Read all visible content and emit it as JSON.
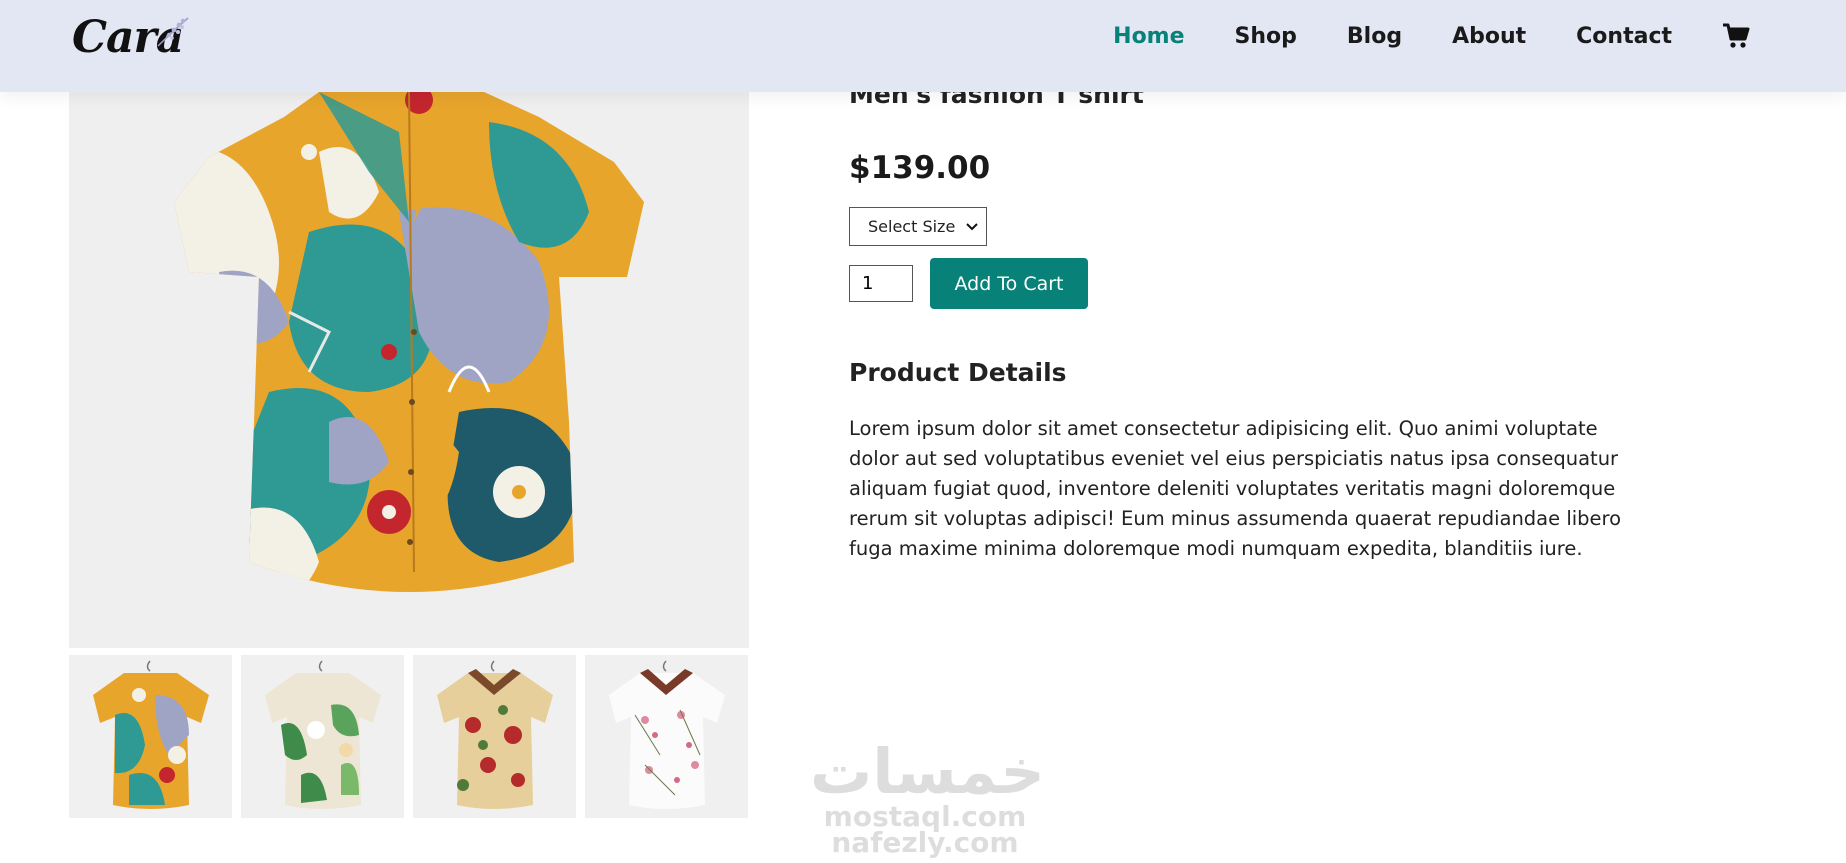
{
  "header": {
    "logo_text": "Cara",
    "nav": [
      "Home",
      "Shop",
      "Blog",
      "About",
      "Contact"
    ],
    "active_nav": "Home",
    "cart_icon": "cart-icon"
  },
  "product": {
    "title": "Men's fashion T shirt",
    "price": "$139.00",
    "size_select": "Select Size",
    "quantity": "1",
    "add_to_cart": "Add To Cart",
    "details_heading": "Product Details",
    "details_text": "Lorem ipsum dolor sit amet consectetur adipisicing elit. Quo animi voluptate dolor aut sed voluptatibus eveniet vel eius perspiciatis natus ipsa consequatur aliquam fugiat quod, inventore deleniti voluptates veritatis magni doloremque rerum sit voluptas adipisci! Eum minus assumenda quaerat repudiandae libero fuga maxime minima doloremque modi numquam expedita, blanditiis iure."
  },
  "watermark": {
    "main": "خمسات",
    "sub1": "mostaql.com",
    "sub2": "nafezly.com"
  },
  "colors": {
    "accent": "#088178",
    "header_bg": "#e3e6f3"
  }
}
